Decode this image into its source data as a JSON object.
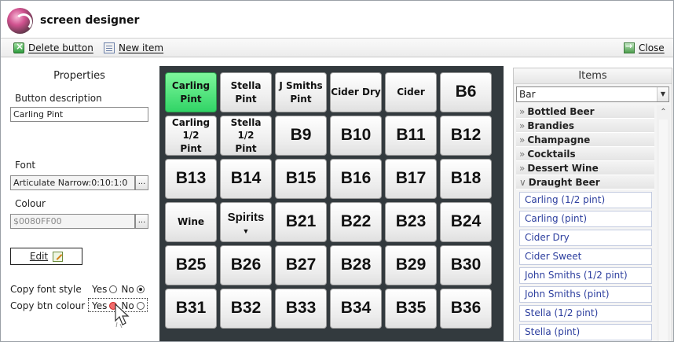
{
  "app": {
    "title": "screen designer"
  },
  "toolbar": {
    "delete_label": "Delete button",
    "new_label": "New item",
    "close_label": "Close"
  },
  "properties": {
    "title": "Properties",
    "description_label": "Button description",
    "description_value": "Carling   Pint",
    "font_label": "Font",
    "font_value": "Articulate Narrow:0:10:1:0",
    "colour_label": "Colour",
    "colour_value": "$0080FF00",
    "ellipsis": "...",
    "edit_label": "Edit",
    "copy_font_label": "Copy font style",
    "copy_colour_label": "Copy btn colour",
    "yes": "Yes",
    "no": "No"
  },
  "colors": {
    "active_button": "#31d466",
    "grid_bg": "#333a3e",
    "item_text": "#2c3e9e"
  },
  "grid": {
    "buttons": [
      [
        "Carling\nPint",
        "Stella\nPint",
        "J Smiths\nPint",
        "Cider Dry",
        "Cider",
        "B6"
      ],
      [
        "Carling  1/2\nPint",
        "Stella 1/2\nPint",
        "B9",
        "B10",
        "B11",
        "B12"
      ],
      [
        "B13",
        "B14",
        "B15",
        "B16",
        "B17",
        "B18"
      ],
      [
        "Wine",
        "Spirits",
        "B21",
        "B22",
        "B23",
        "B24"
      ],
      [
        "B25",
        "B26",
        "B27",
        "B28",
        "B29",
        "B30"
      ],
      [
        "B31",
        "B32",
        "B33",
        "B34",
        "B35",
        "B36"
      ]
    ],
    "selected": "Carling\nPint"
  },
  "items": {
    "title": "Items",
    "filter_value": "Bar",
    "categories": [
      {
        "label": "Bottled Beer",
        "expanded": false
      },
      {
        "label": "Brandies",
        "expanded": false
      },
      {
        "label": "Champagne",
        "expanded": false
      },
      {
        "label": "Cocktails",
        "expanded": false
      },
      {
        "label": "Dessert Wine",
        "expanded": false
      },
      {
        "label": "Draught Beer",
        "expanded": true
      }
    ],
    "draught_items": [
      "Carling (1/2 pint)",
      "Carling (pint)",
      "Cider Dry",
      "Cider Sweet",
      "John Smiths (1/2 pint)",
      "John Smiths (pint)",
      "Stella (1/2 pint)",
      "Stella (pint)"
    ]
  }
}
